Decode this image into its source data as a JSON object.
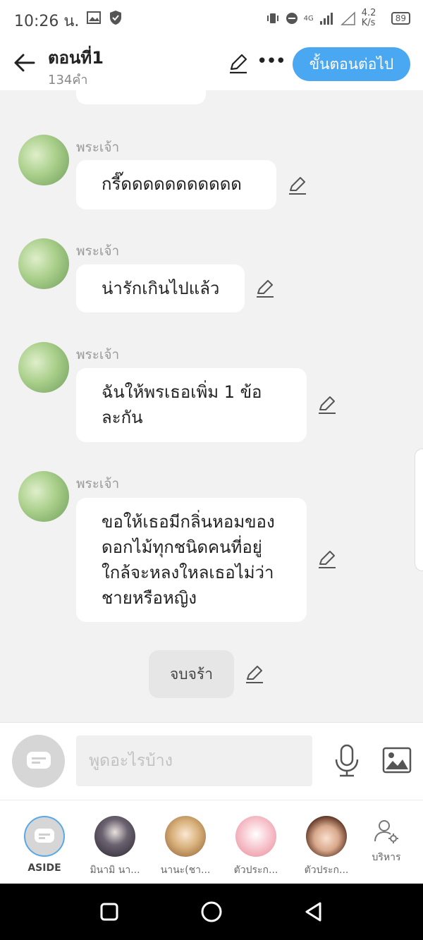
{
  "status_bar": {
    "time": "10:26 น.",
    "network": "4G",
    "speed": "4.2 K/s",
    "battery": "89"
  },
  "header": {
    "title": "ตอนที่1",
    "word_count": "134คำ",
    "next_button": "ขั้นตอนต่อไป",
    "accent_color": "#4aa8f2"
  },
  "messages": [
    {
      "sender": "พระเจ้า",
      "text": "กรี๊ดดดดดดดดดดด"
    },
    {
      "sender": "พระเจ้า",
      "text": "น่ารักเกินไปแล้ว"
    },
    {
      "sender": "พระเจ้า",
      "text": "ฉันให้พรเธอเพิ่ม 1 ข้อ\nละกัน"
    },
    {
      "sender": "พระเจ้า",
      "text": "ขอให้เธอมีกลิ่นหอมของ\nดอกไม้ทุกชนิดคนที่อยู่\nใกล้จะหลงใหลเธอไม่ว่า\nชายหรือหญิง"
    }
  ],
  "aside_message": "จบจร้า",
  "input": {
    "placeholder": "พูดอะไรบ้าง"
  },
  "characters": [
    {
      "name": "ASIDE"
    },
    {
      "name": "มินามิ นา..."
    },
    {
      "name": "นานะ(ชา..."
    },
    {
      "name": "ตัวประก..."
    },
    {
      "name": "ตัวประก..."
    },
    {
      "name": "บริหาร"
    }
  ]
}
